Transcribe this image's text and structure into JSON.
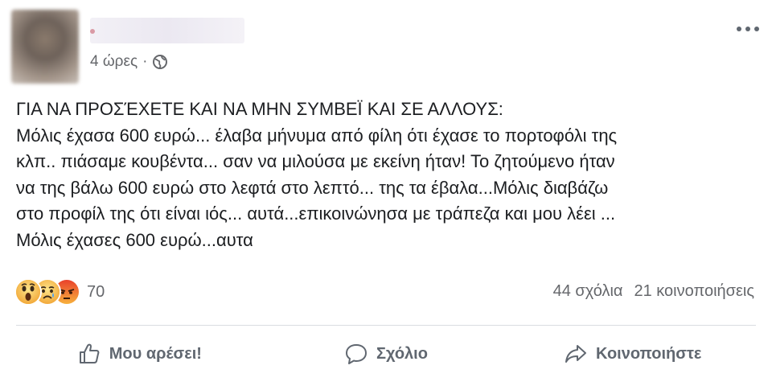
{
  "post": {
    "timestamp": "4 ώρες",
    "separator": "·",
    "body": "ΓΙΑ ΝΑ ΠΡΟΣΈΧΕΤΕ ΚΑΙ ΝΑ ΜΗΝ ΣΥΜΒΕΪ ΚΑΙ ΣΕ ΑΛΛΟΥΣ:\nΜόλις έχασα 600 ευρώ... έλαβα μήνυμα από φίλη ότι έχασε το πορτοφόλι της\nκλπ.. πιάσαμε κουβέντα... σαν να μιλούσα με εκείνη ήταν! Το ζητούμενο ήταν\nνα της βάλω 600 ευρώ στο λεφτά στο λεπτό... της τα έβαλα...Μόλις διαβάζω\nστο προφίλ της ότι είναι ιός... αυτά...επικοινώνησα με τράπεζα και μου λέει ...\nΜόλις έχασες 600 ευρώ...αυτα"
  },
  "reactions": {
    "icons": [
      "wow-icon",
      "sad-icon",
      "angry-icon"
    ],
    "count": "70"
  },
  "stats": {
    "comments": "44 σχόλια",
    "shares": "21 κοινοποιήσεις"
  },
  "actions": {
    "like": "Μου αρέσει!",
    "comment": "Σχόλιο",
    "share": "Κοινοποιήστε"
  },
  "colors": {
    "secondary_text": "#65676b",
    "action_text": "#606770",
    "divider": "#dadde1"
  }
}
